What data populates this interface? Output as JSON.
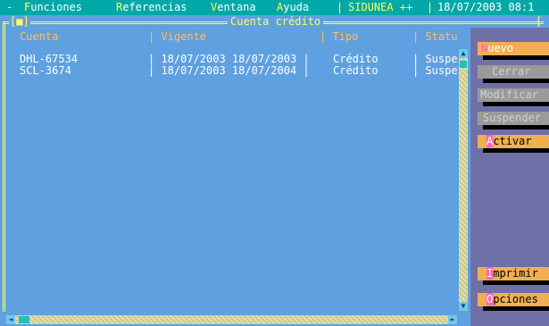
{
  "menubar": {
    "dash": "-",
    "funciones_hot": "F",
    "funciones_rest": "unciones",
    "referencias_hot": "R",
    "referencias_rest": "eferencias",
    "ventana_hot": "V",
    "ventana_rest": "entana",
    "ayuda_hot": "A",
    "ayuda_rest": "yuda",
    "sep1": "|",
    "app": "SIDUNEA ++",
    "sep2": "|",
    "datetime": "18/07/2003 08:1"
  },
  "window": {
    "closebox": "[■]",
    "title": "Cuenta crédito",
    "right_corner": "[",
    "columns": {
      "cuenta": "Cuenta",
      "vigente": "| Vigente",
      "tipo": "| Tipo",
      "status": "| Statu"
    },
    "rows": [
      {
        "cuenta": "DHL-67534",
        "vigente": "| 18/07/2003 18/07/2003 |",
        "tipo": "Crédito",
        "status": "| Suspe"
      },
      {
        "cuenta": "SCL-3674",
        "vigente": "| 18/07/2003 18/07/2004 |",
        "tipo": "Crédito",
        "status": "| Suspe"
      }
    ]
  },
  "buttons": {
    "nuevo": {
      "hot": "N",
      "rest": "uevo"
    },
    "cerrar": "Cerrar",
    "modificar": "Modificar",
    "suspender": "Suspender",
    "activar": {
      "hot": "A",
      "rest": "ctivar"
    },
    "imprimir": {
      "hot": "I",
      "rest": "mprimir"
    },
    "opciones": {
      "hot": "O",
      "rest": "pciones"
    }
  },
  "colors": {
    "menubar_bg": "#00a8a8",
    "window_bg": "#5fa0e0",
    "frame": "#ffff55",
    "header_text": "#ffbf60",
    "panel_bg": "#7070a8",
    "button_active": "#f0b050",
    "button_disabled": "#9a9a9a"
  }
}
